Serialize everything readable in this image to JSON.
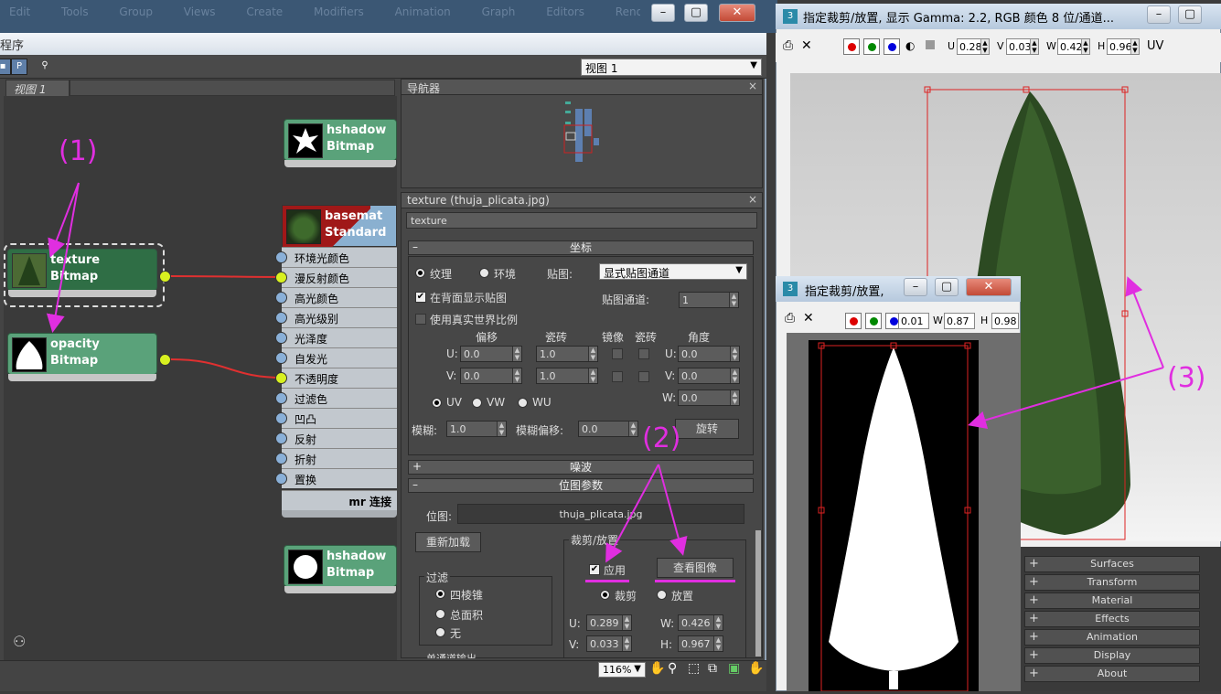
{
  "top_bg": {
    "blur_menu": "Edit Tools Group Views Create Modifiers Animation Graph Editors Rendering Civil View Customize MAXScript Help"
  },
  "slate": {
    "title": "程序",
    "view_tab": "视图 1",
    "view_select": "视图 1",
    "nodes": {
      "hshadow_top": {
        "name": "hshadow",
        "type": "Bitmap"
      },
      "texture": {
        "name": "texture",
        "type": "Bitmap"
      },
      "opacity": {
        "name": "opacity",
        "type": "Bitmap"
      },
      "basemat": {
        "name": "basemat",
        "type": "Standard"
      },
      "hshadow_bottom": {
        "name": "hshadow",
        "type": "Bitmap"
      }
    },
    "slots": [
      "环境光颜色",
      "漫反射颜色",
      "高光颜色",
      "高光级别",
      "光泽度",
      "自发光",
      "不透明度",
      "过滤色",
      "凹凸",
      "反射",
      "折射",
      "置换"
    ],
    "mr_link": "mr 连接",
    "zoom": "116%"
  },
  "navigator": {
    "title": "导航器"
  },
  "texture_panel": {
    "title": "texture (thuja_plicata.jpg)",
    "name_field": "texture",
    "coords_title": "坐标",
    "opt_texture": "纹理",
    "opt_env": "环境",
    "map_label": "贴图:",
    "map_value": "显式贴图通道",
    "show_back": "在背面显示贴图",
    "map_channel_label": "贴图通道:",
    "map_channel_value": "1",
    "real_world": "使用真实世界比例",
    "col_offset": "偏移",
    "col_tiling": "瓷砖",
    "col_mirror": "镜像",
    "col_tile2": "瓷砖",
    "col_angle": "角度",
    "u_label": "U:",
    "v_label": "V:",
    "w_label": "W:",
    "u_offset": "0.0",
    "v_offset": "0.0",
    "u_tiling": "1.0",
    "v_tiling": "1.0",
    "u_angle": "0.0",
    "v_angle": "0.0",
    "w_angle": "0.0",
    "uv": "UV",
    "vw": "VW",
    "wu": "WU",
    "blur_label": "模糊:",
    "blur_value": "1.0",
    "blur_offset_label": "模糊偏移:",
    "blur_offset_value": "0.0",
    "rotate_btn": "旋转",
    "noise_title": "噪波",
    "bitmap_params_title": "位图参数",
    "bitmap_label": "位图:",
    "bitmap_value": "thuja_plicata.jpg",
    "reload_btn": "重新加载",
    "crop_group": "裁剪/放置",
    "apply": "应用",
    "view_image_btn": "查看图像",
    "crop": "裁剪",
    "place": "放置",
    "crop_u": "0.289",
    "crop_v": "0.033",
    "crop_w": "0.426",
    "crop_h": "0.967",
    "h_label": "H:",
    "filter_group": "过滤",
    "filter_pyramid": "四棱锥",
    "filter_sum": "总面积",
    "filter_none": "无",
    "single_output": "单通道输出"
  },
  "big_window": {
    "title": "指定裁剪/放置, 显示 Gamma: 2.2, RGB 颜色 8 位/通道...",
    "u_label": "U",
    "u_value": "0.28",
    "v_label": "V",
    "v_value": "0.03",
    "w_label": "W",
    "w_value": "0.42",
    "h_label": "H",
    "h_value": "0.96",
    "uv": "UV"
  },
  "small_window": {
    "title": "指定裁剪/放置,",
    "val1": "0.01",
    "w_label": "W",
    "w_value": "0.87",
    "h_label": "H",
    "h_value": "0.98"
  },
  "rollout": [
    "Surfaces",
    "Transform",
    "Material",
    "Effects",
    "Animation",
    "Display",
    "About"
  ],
  "annotations": {
    "a1": "(1)",
    "a2": "(2)",
    "a3": "(3)"
  },
  "colors": {
    "accent_magenta": "#e02ee0",
    "node_green": "#5aa27a",
    "wire_red": "#e03030",
    "socket_yellow": "#d8f020"
  }
}
